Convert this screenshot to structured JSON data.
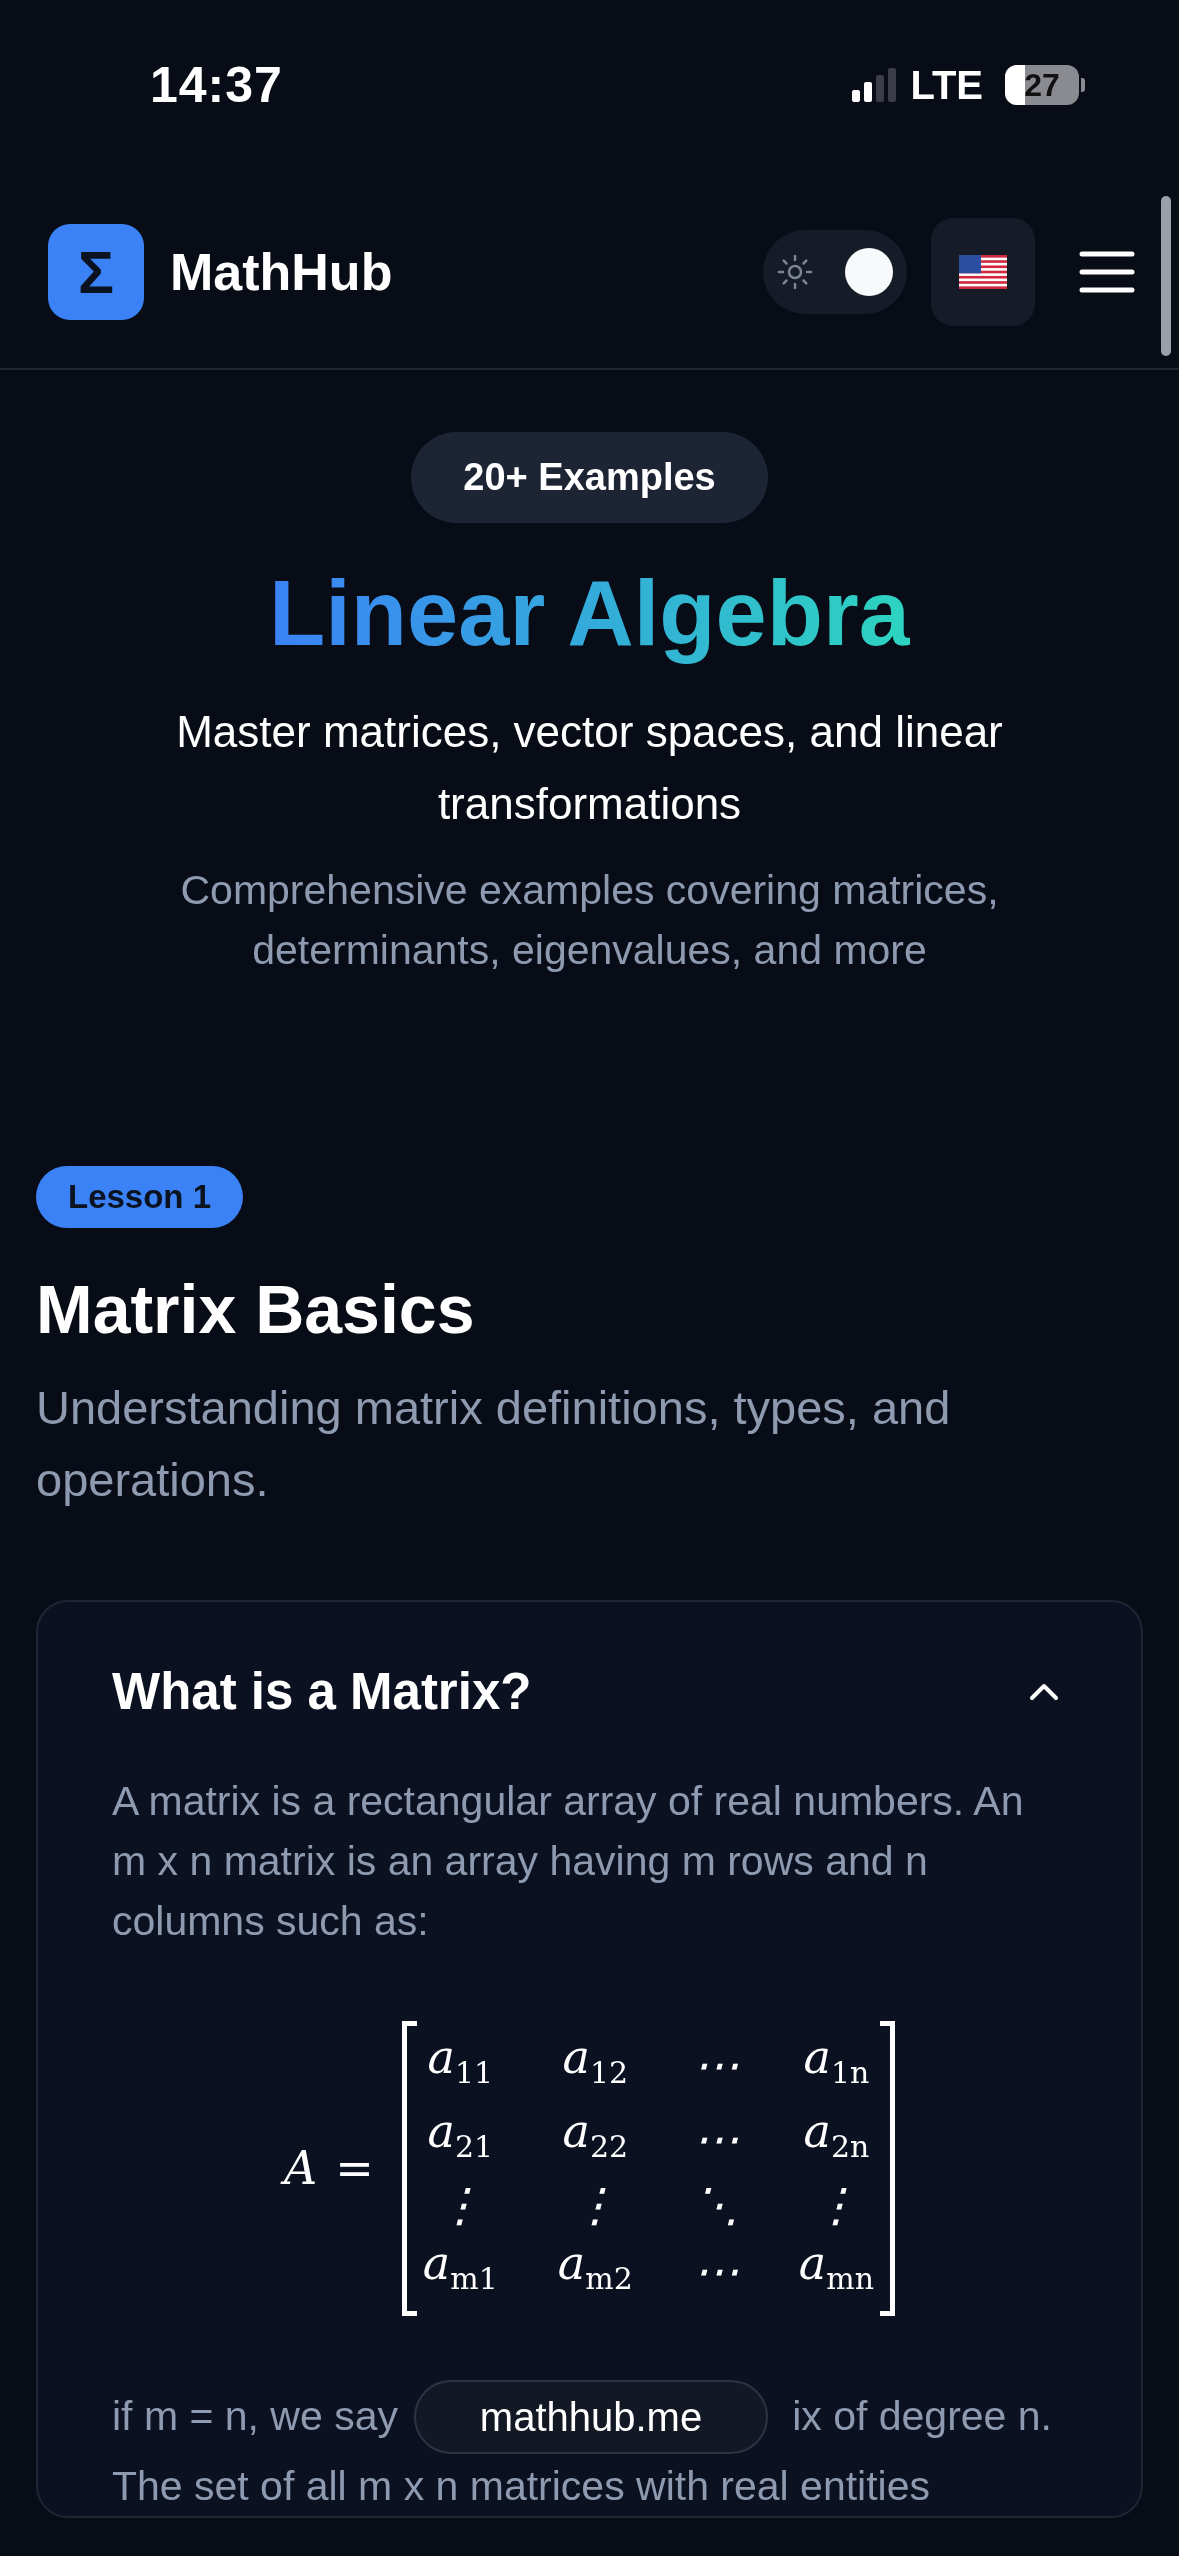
{
  "status_bar": {
    "time": "14:37",
    "network": "LTE",
    "battery": {
      "reading": "27",
      "level": 0.27
    }
  },
  "header": {
    "logo_mark": "Σ",
    "brand": "MathHub",
    "theme_toggle": {
      "on": true
    }
  },
  "hero": {
    "badge": "20+ Examples",
    "title": "Linear Algebra",
    "subtitle": "Master matrices, vector spaces, and linear transformations",
    "description": "Comprehensive examples covering matrices, determinants, eigenvalues, and more"
  },
  "lesson": {
    "badge": "Lesson 1",
    "title": "Matrix Basics",
    "description": "Understanding matrix definitions, types, and operations."
  },
  "card": {
    "title": "What is a Matrix?",
    "expanded": true,
    "paragraph": "A matrix is a rectangular array of real numbers. An m x n matrix is an array having m rows and n columns such as:",
    "matrix": {
      "lhs": "A",
      "equals": "=",
      "rows": [
        [
          "a$_{11}$",
          "a$_{12}$",
          "⋯",
          "a$_{1n}$"
        ],
        [
          "a$_{21}$",
          "a$_{22}$",
          "⋯",
          "a$_{2n}$"
        ],
        [
          "⋮",
          "⋮",
          "⋱",
          "⋮"
        ],
        [
          "a$_{m1}$",
          "a$_{m2}$",
          "⋯",
          "a$_{mn}$"
        ]
      ]
    },
    "after_left": "if m = n, we say",
    "after_right": "ix of degree n.",
    "after_line2": "The set of all m x n matrices with real entities"
  },
  "url_pill": "mathhub.me"
}
